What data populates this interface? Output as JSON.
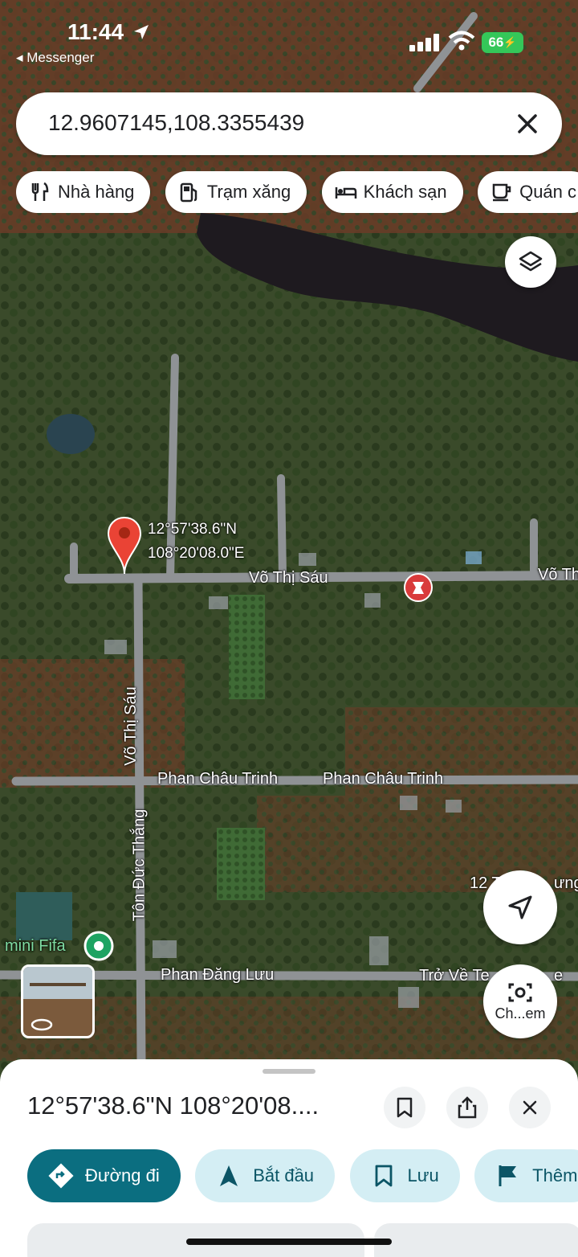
{
  "status_bar": {
    "time": "11:44",
    "back_app": "◂ Messenger",
    "battery": "66"
  },
  "search": {
    "query": "12.9607145,108.3355439"
  },
  "chips": [
    {
      "label": "Nhà hàng",
      "icon": "fork-knife-icon"
    },
    {
      "label": "Trạm xăng",
      "icon": "gas-station-icon"
    },
    {
      "label": "Khách sạn",
      "icon": "bed-icon"
    },
    {
      "label": "Quán c",
      "icon": "coffee-icon"
    }
  ],
  "map": {
    "pin_lat": "12°57'38.6\"N",
    "pin_lng": "108°20'08.0\"E",
    "streets": {
      "vo_thi_sau_h": "Võ Thị Sáu",
      "vo_thi_sau_h2": "Võ Th",
      "vo_thi_sau_v": "Võ Thị Sáu",
      "phan_chau_trinh_1": "Phan Châu Trinh",
      "phan_chau_trinh_2": "Phan Châu Trinh",
      "ton_duc_thang": "Tôn Đức Thắng",
      "phan_dang_luu": "Phan Đăng Lưu",
      "tro_ve": "Trở Về Te",
      "tro_ve_end": "e",
      "twelve": "12 T",
      "twelve_end": "ưng"
    },
    "poi_mini_fifa": "mini Fifa",
    "choose_label": "Ch...em",
    "colors": {
      "pin": "#ea4335",
      "poi_green": "#1ea362",
      "pharmacy": "#d93b3b"
    }
  },
  "sheet": {
    "title": "12°57'38.6\"N 108°20'08....",
    "actions": [
      {
        "label": "Đường đi",
        "icon": "directions-icon",
        "style": "primary"
      },
      {
        "label": "Bắt đầu",
        "icon": "navigation-arrow-icon",
        "style": "secondary"
      },
      {
        "label": "Lưu",
        "icon": "bookmark-icon",
        "style": "secondary"
      },
      {
        "label": "Thêm",
        "icon": "flag-icon",
        "style": "secondary"
      }
    ]
  }
}
